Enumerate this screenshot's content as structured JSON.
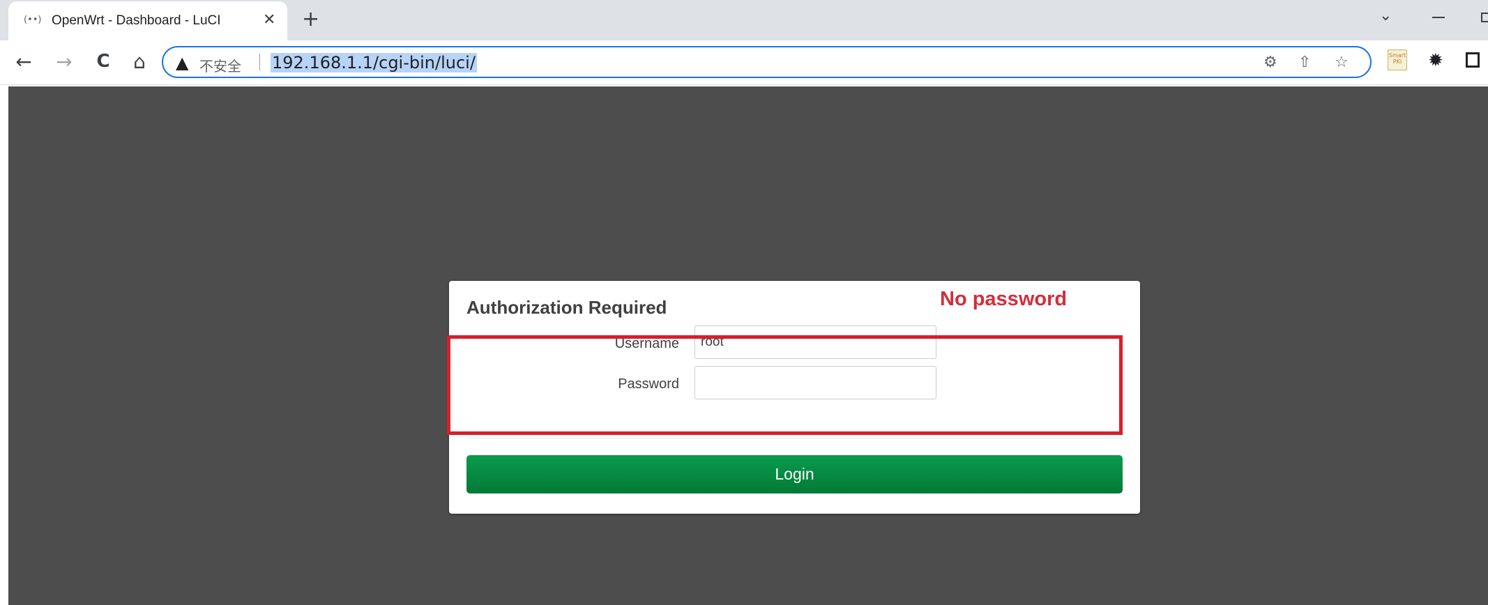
{
  "browser": {
    "tab": {
      "favicon": "(••)",
      "title": "OpenWrt - Dashboard - LuCI",
      "close_glyph": "✕"
    },
    "new_tab_glyph": "+",
    "tab_search_glyph": "⌄",
    "toolbar": {
      "back_glyph": "←",
      "forward_glyph": "→",
      "reload_glyph": "C",
      "home_glyph": "⌂",
      "security_icon": "▲",
      "security_text": "不安全",
      "url": "192.168.1.1/cgi-bin/luci/",
      "translate_glyph": "⚙",
      "share_glyph": "⇧",
      "bookmark_glyph": "☆",
      "extension_smart_label": "Smart\nPKI",
      "extensions_glyph": "✹"
    },
    "icons": [
      "favicon-icon",
      "close-icon",
      "plus-icon",
      "chevron-down-icon",
      "minimize-icon",
      "restore-icon",
      "back-icon",
      "forward-icon",
      "reload-icon",
      "home-icon",
      "warning-icon",
      "translate-icon",
      "share-icon",
      "star-icon",
      "puzzle-icon",
      "side-panel-icon"
    ]
  },
  "login": {
    "title": "Authorization Required",
    "username_label": "Username",
    "username_value": "root",
    "password_label": "Password",
    "password_value": "",
    "login_button": "Login"
  },
  "annotation": {
    "note": "No password",
    "color": "#d32d3a"
  },
  "colors": {
    "page_background": "#4d4d4d",
    "login_button": "#028c40",
    "omnibox_border": "#1a73e8"
  }
}
